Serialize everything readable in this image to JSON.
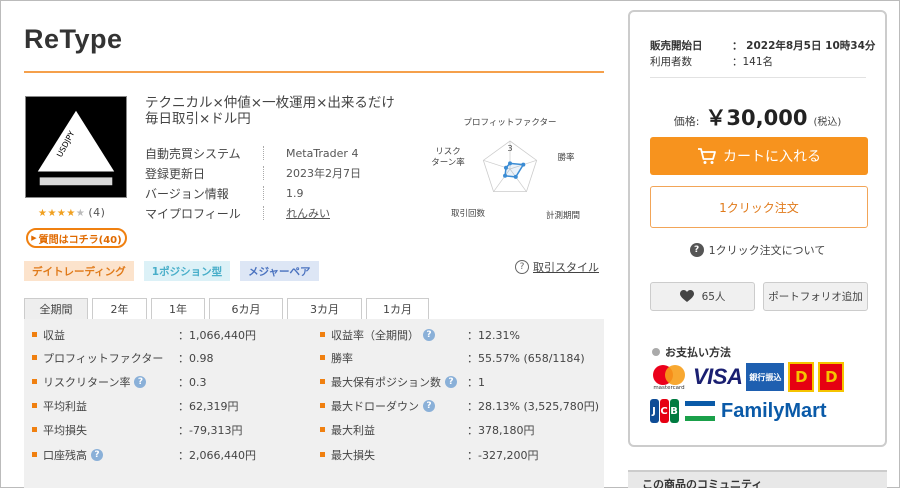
{
  "product": {
    "title": "ReType",
    "description_line1": "テクニカル×仲値×一枚運用×出来るだけ",
    "description_line2": "毎日取引×ドル円",
    "logo_text": "USDJPY",
    "rating": 3.5,
    "review_count": "(4)",
    "question_button": "質問はコチラ(40)"
  },
  "specs": [
    {
      "label": "自動売買システム",
      "value": "MetaTrader 4"
    },
    {
      "label": "登録更新日",
      "value": "2023年2月7日"
    },
    {
      "label": "バージョン情報",
      "value": "1.9"
    },
    {
      "label": "マイプロフィール",
      "value": "れんみい"
    }
  ],
  "radar": {
    "center_label": "3",
    "axes": [
      "プロフィットファクター",
      "勝率",
      "計測期間",
      "取引回数",
      "リスク\nターン率"
    ],
    "values": [
      0.2,
      0.5,
      0.35,
      0.3,
      0.15
    ],
    "max": 5
  },
  "tags": [
    "デイトレーディング",
    "1ポジション型",
    "メジャーペア"
  ],
  "style_link": "取引スタイル",
  "tabs": [
    "全期間",
    "2年",
    "1年",
    "6カ月",
    "3カ月",
    "1カ月"
  ],
  "stats_left": [
    {
      "label": "収益",
      "value": "：1,066,440円",
      "help": false
    },
    {
      "label": "プロフィットファクター",
      "value": "：0.98",
      "help": false
    },
    {
      "label": "リスクリターン率",
      "value": "：0.3",
      "help": true
    },
    {
      "label": "平均利益",
      "value": "：62,319円",
      "help": false
    },
    {
      "label": "平均損失",
      "value": "：-79,313円",
      "help": false
    },
    {
      "label": "口座残高",
      "value": "：2,066,440円",
      "help": true
    }
  ],
  "stats_right": [
    {
      "label": "収益率（全期間）",
      "value": "：12.31%",
      "help": true
    },
    {
      "label": "勝率",
      "value": "：55.57% (658/1184)",
      "help": false
    },
    {
      "label": "最大保有ポジション数",
      "value": "：1",
      "help": true
    },
    {
      "label": "最大ドローダウン",
      "value": "：28.13% (3,525,780円)",
      "help": true
    },
    {
      "label": "最大利益",
      "value": "：378,180円",
      "help": false
    },
    {
      "label": "最大損失",
      "value": "：-327,200円",
      "help": false
    }
  ],
  "sidebar": {
    "sale_start_label": "販売開始日",
    "sale_start_value": "：  2022年8月5日 10時34分",
    "users_label": "利用者数",
    "users_value": "：141名",
    "price_label": "価格:",
    "price_value": "￥30,000",
    "price_tax": "(税込)",
    "cart_button": "カートに入れる",
    "oneclick_button": "1クリック注文",
    "oneclick_about": "1クリック注文について",
    "favorite_count": "65人",
    "portfolio_button": "ポートフォリオ追加",
    "payment_title": "お支払い方法",
    "mastercard_text": "mastercard",
    "visa_text": "VISA",
    "bank_text": "銀行振込",
    "daily_text": "D",
    "daily2_text": "D",
    "familymart_text": "FamilyMart",
    "community_title": "この商品のコミュニティ"
  },
  "colors": {
    "accent": "#f7931e",
    "accent_border": "#f08010"
  }
}
